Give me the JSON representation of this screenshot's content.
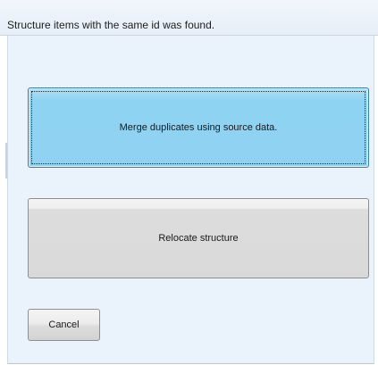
{
  "dialog": {
    "title": "Structure items with the same id was found."
  },
  "buttons": {
    "merge_label": "Merge duplicates using source data.",
    "relocate_label": "Relocate structure",
    "cancel_label": "Cancel"
  },
  "colors": {
    "content_background": "#eaf2fc",
    "merge_button_fill": "#8fd2f1",
    "merge_button_border": "#3a7da3",
    "neutral_button_fill": "#d9d9d9"
  }
}
